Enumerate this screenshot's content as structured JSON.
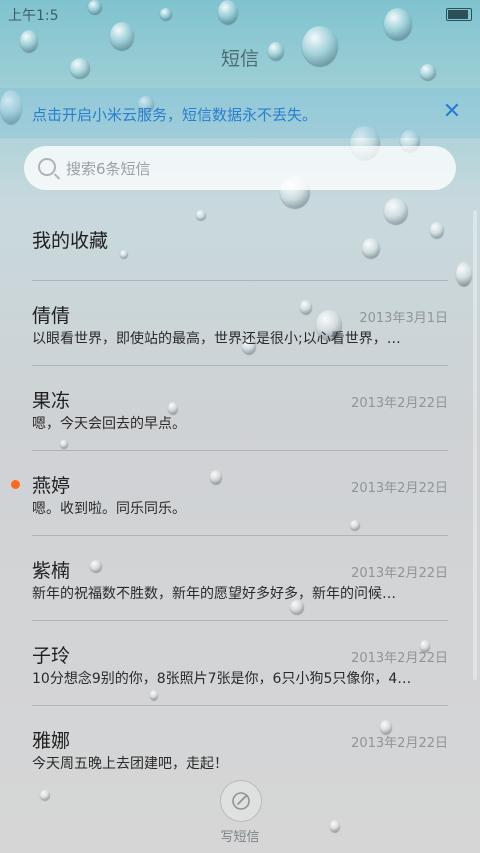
{
  "status_bar": {
    "time": "上午1:5"
  },
  "app": {
    "title": "短信"
  },
  "banner": {
    "text": "点击开启小米云服务，短信数据永不丢失。",
    "close_icon": "close-icon"
  },
  "search": {
    "placeholder": "搜索6条短信"
  },
  "favorites": {
    "label": "我的收藏"
  },
  "messages": [
    {
      "name": "倩倩",
      "date": "2013年3月1日",
      "preview": "以眼看世界，即使站的最高，世界还是很小;以心看世界，…",
      "unread": false
    },
    {
      "name": "果冻",
      "date": "2013年2月22日",
      "preview": "嗯，今天会回去的早点。",
      "unread": false
    },
    {
      "name": "燕婷",
      "date": "2013年2月22日",
      "preview": "嗯。收到啦。同乐同乐。",
      "unread": true
    },
    {
      "name": "紫楠",
      "date": "2013年2月22日",
      "preview": "新年的祝福数不胜数，新年的愿望好多好多，新年的问候…",
      "unread": false
    },
    {
      "name": "子玲",
      "date": "2013年2月22日",
      "preview": "10分想念9别的你，8张照片7张是你，6只小狗5只像你，4…",
      "unread": false
    },
    {
      "name": "雅娜",
      "date": "2013年2月22日",
      "preview": "今天周五晚上去团建吧，走起！",
      "unread": false
    }
  ],
  "compose": {
    "label": "写短信",
    "icon": "compose-icon"
  },
  "colors": {
    "accent": "#2a7ed0",
    "unread": "#ff6a1a"
  }
}
